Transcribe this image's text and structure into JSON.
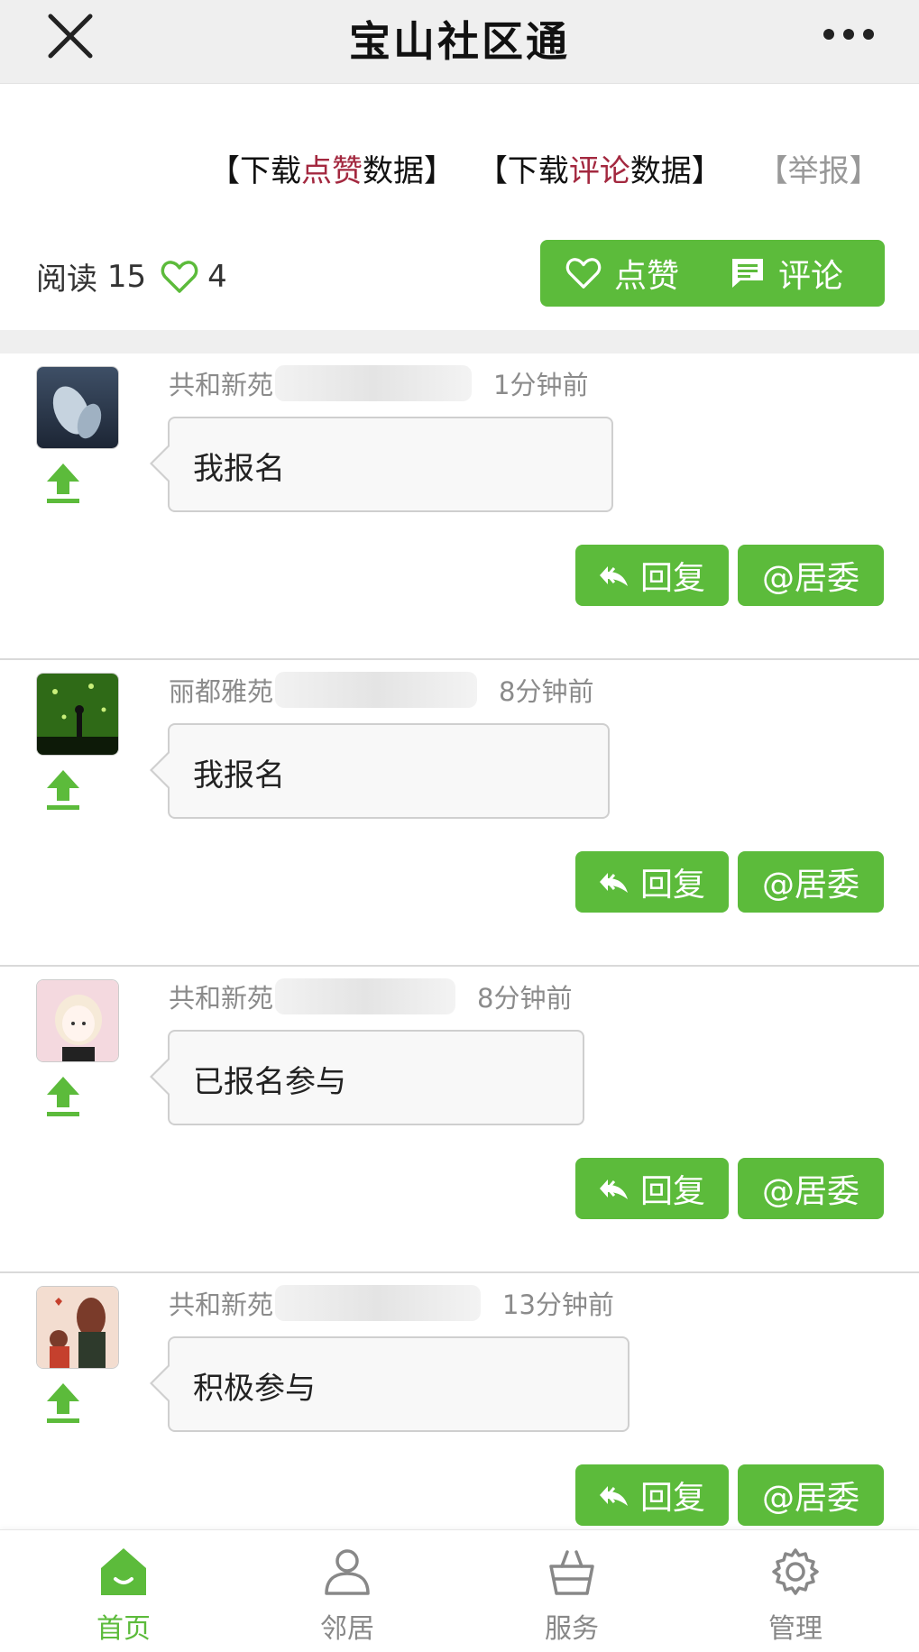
{
  "header": {
    "title": "宝山社区通",
    "close_icon": "close-icon",
    "more_icon": "more-icon"
  },
  "links": {
    "download_likes": {
      "pre": "【下载",
      "hl": "点赞",
      "post": "数据】"
    },
    "download_comments": {
      "pre": "【下载",
      "hl": "评论",
      "post": "数据】"
    },
    "report": "【举报】"
  },
  "stats": {
    "read_label": "阅读",
    "read_count": "15",
    "like_count": "4"
  },
  "actions": {
    "like_label": "点赞",
    "comment_label": "评论"
  },
  "comments": [
    {
      "author": "共和新苑",
      "time": "1分钟前",
      "text": "我报名",
      "reply_label": "回复",
      "at_label": "@居委",
      "avatar": "dolphin-avatar"
    },
    {
      "author": "丽都雅苑",
      "time": "8分钟前",
      "text": "我报名",
      "reply_label": "回复",
      "at_label": "@居委",
      "avatar": "green-field-avatar"
    },
    {
      "author": "共和新苑",
      "time": "8分钟前",
      "text": "已报名参与",
      "reply_label": "回复",
      "at_label": "@居委",
      "avatar": "anime-girl-avatar"
    },
    {
      "author": "共和新苑",
      "time": "13分钟前",
      "text": "积极参与",
      "reply_label": "回复",
      "at_label": "@居委",
      "avatar": "mother-child-avatar"
    }
  ],
  "tabbar": [
    {
      "label": "首页",
      "icon": "home-icon",
      "active": true
    },
    {
      "label": "邻居",
      "icon": "person-icon",
      "active": false
    },
    {
      "label": "服务",
      "icon": "basket-icon",
      "active": false
    },
    {
      "label": "管理",
      "icon": "gear-icon",
      "active": false
    }
  ],
  "colors": {
    "accent": "#5cbb3b",
    "highlight": "#a3283f"
  }
}
